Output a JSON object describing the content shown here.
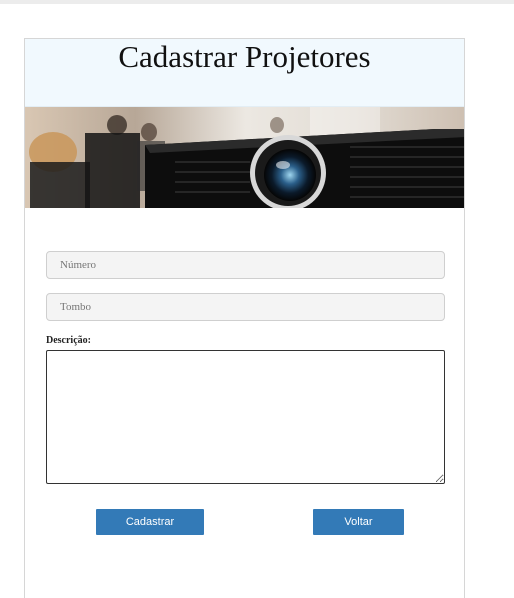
{
  "page": {
    "title": "Cadastrar Projetores"
  },
  "form": {
    "numero_placeholder": "Número",
    "tombo_placeholder": "Tombo",
    "descricao_label": "Descrição:",
    "descricao_value": ""
  },
  "actions": {
    "submit_label": "Cadastrar",
    "back_label": "Voltar"
  },
  "colors": {
    "header_bg": "#f1f9fe",
    "button_bg": "#337ab7",
    "field_bg": "#f4f4f4"
  }
}
